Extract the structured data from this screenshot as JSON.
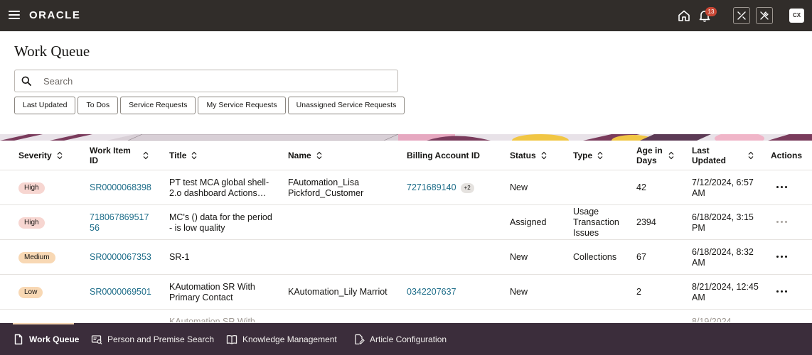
{
  "header": {
    "brand": "ORACLE",
    "notification_count": "13",
    "avatar_initials": "CX"
  },
  "page": {
    "title": "Work Queue"
  },
  "search": {
    "placeholder": "Search"
  },
  "filters": [
    {
      "label": "Last Updated"
    },
    {
      "label": "To Dos"
    },
    {
      "label": "Service Requests"
    },
    {
      "label": "My Service Requests"
    },
    {
      "label": "Unassigned Service Requests"
    }
  ],
  "table": {
    "columns": {
      "severity": "Severity",
      "work_item_id": "Work Item ID",
      "title": "Title",
      "name": "Name",
      "billing_account_id": "Billing Account ID",
      "status": "Status",
      "type": "Type",
      "age_in_days": "Age in Days",
      "last_updated": "Last Updated",
      "actions": "Actions"
    },
    "rows": [
      {
        "severity": "High",
        "work_item_id": "SR0000068398",
        "title": "PT test MCA global shell-2.o dashboard Actions…",
        "name": "FAutomation_Lisa Pickford_Customer",
        "billing_account_id": "7271689140",
        "billing_extra": "+2",
        "status": "New",
        "type": "",
        "age_in_days": "42",
        "last_updated": "7/12/2024, 6:57 AM"
      },
      {
        "severity": "High",
        "work_item_id": "71806786951756",
        "title": "MC's () data for the period - is low quality",
        "name": "",
        "billing_account_id": "",
        "billing_extra": "",
        "status": "Assigned",
        "type": "Usage Transaction Issues",
        "age_in_days": "2394",
        "last_updated": "6/18/2024, 3:15 PM"
      },
      {
        "severity": "Medium",
        "work_item_id": "SR0000067353",
        "title": "SR-1",
        "name": "",
        "billing_account_id": "",
        "billing_extra": "",
        "status": "New",
        "type": "Collections",
        "age_in_days": "67",
        "last_updated": "6/18/2024, 8:32 AM"
      },
      {
        "severity": "Low",
        "work_item_id": "SR0000069501",
        "title": "KAutomation SR With Primary Contact",
        "name": "KAutomation_Lily Marriot",
        "billing_account_id": "0342207637",
        "billing_extra": "",
        "status": "New",
        "type": "",
        "age_in_days": "2",
        "last_updated": "8/21/2024, 12:45 AM"
      }
    ],
    "partial_row": {
      "title": "KAutomation SR With",
      "last_updated": "8/19/2024"
    }
  },
  "bottom_nav": [
    {
      "label": "Work Queue",
      "active": true
    },
    {
      "label": "Person and Premise Search",
      "active": false
    },
    {
      "label": "Knowledge Management",
      "active": false
    },
    {
      "label": "Article Configuration",
      "active": false
    }
  ],
  "colors": {
    "header_bg": "#312d2a",
    "bottom_nav_bg": "#3b2d3b",
    "link": "#1f6e8a",
    "severity_high": "#f7d6d1",
    "severity_medium": "#f8d8b4",
    "notification_badge": "#c74634"
  },
  "icons": {
    "menu": "hamburger-icon",
    "home": "home-icon",
    "notifications": "bell-icon",
    "tool_1": "tools-icon",
    "tool_2": "wrench-icon",
    "search": "search-icon",
    "sort": "sort-icon",
    "row_actions": "more-horizontal-icon",
    "nav_work_queue": "document-icon",
    "nav_person_search": "id-card-search-icon",
    "nav_knowledge": "book-icon",
    "nav_article": "document-edit-icon"
  }
}
